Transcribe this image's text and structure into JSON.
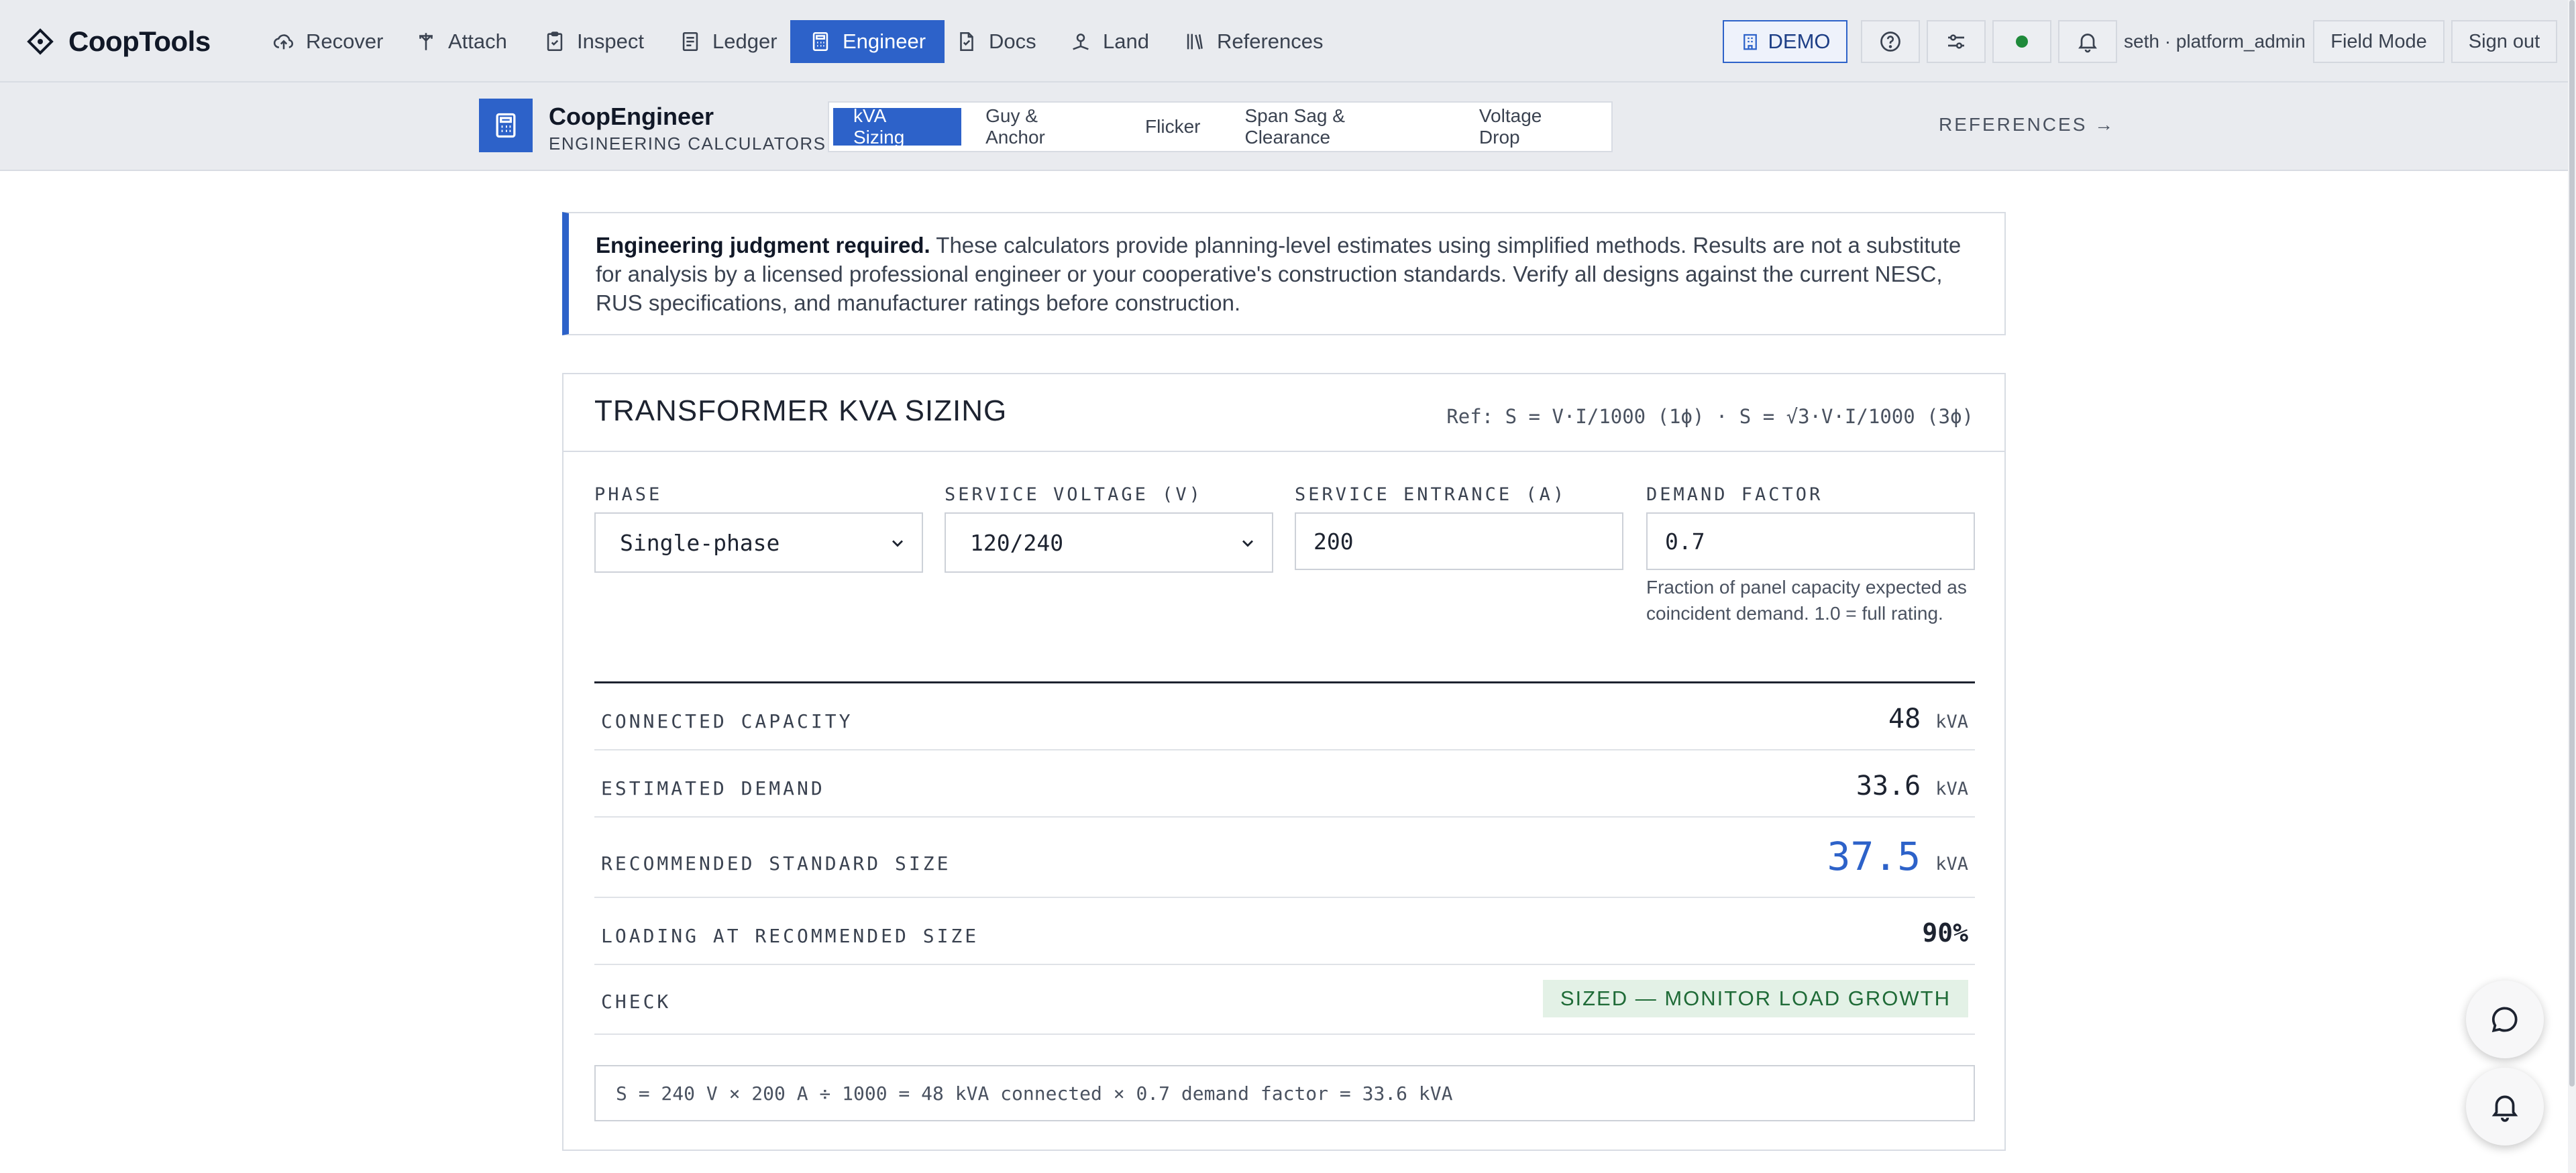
{
  "app": {
    "name": "CoopTools"
  },
  "nav": {
    "items": [
      {
        "label": "Recover",
        "icon": "cloud-upload-icon"
      },
      {
        "label": "Attach",
        "icon": "pole-icon"
      },
      {
        "label": "Inspect",
        "icon": "clipboard-check-icon"
      },
      {
        "label": "Ledger",
        "icon": "ledger-icon"
      },
      {
        "label": "Engineer",
        "icon": "calculator-icon",
        "active": true
      },
      {
        "label": "Docs",
        "icon": "document-icon"
      },
      {
        "label": "Land",
        "icon": "land-icon"
      },
      {
        "label": "References",
        "icon": "books-icon"
      }
    ],
    "demo_label": "DEMO",
    "status_color": "#1f8a3b",
    "user": "seth · platform_admin",
    "field_mode": "Field Mode",
    "sign_out": "Sign out"
  },
  "subheader": {
    "title": "CoopEngineer",
    "caption": "ENGINEERING CALCULATORS",
    "tabs": [
      "kVA Sizing",
      "Guy & Anchor",
      "Flicker",
      "Span Sag & Clearance",
      "Voltage Drop"
    ],
    "active_tab": "kVA Sizing",
    "references_link": "REFERENCES →"
  },
  "notice": {
    "bold": "Engineering judgment required.",
    "text": " These calculators provide planning-level estimates using simplified methods. Results are not a substitute for analysis by a licensed professional engineer or your cooperative's construction standards. Verify all designs against the current NESC, RUS specifications, and manufacturer ratings before construction."
  },
  "calculator": {
    "title": "TRANSFORMER KVA SIZING",
    "ref": "Ref: S = V·I/1000 (1ϕ) · S = √3·V·I/1000 (3ϕ)",
    "fields": {
      "phase": {
        "label": "PHASE",
        "value": "Single-phase"
      },
      "voltage": {
        "label": "SERVICE VOLTAGE (V)",
        "value": "120/240"
      },
      "entrance": {
        "label": "SERVICE ENTRANCE (A)",
        "value": "200"
      },
      "demand": {
        "label": "DEMAND FACTOR",
        "value": "0.7",
        "help": "Fraction of panel capacity expected as coincident demand. 1.0 = full rating."
      }
    },
    "results": {
      "connected": {
        "label": "CONNECTED CAPACITY",
        "value": "48",
        "unit": "kVA"
      },
      "demand": {
        "label": "ESTIMATED DEMAND",
        "value": "33.6",
        "unit": "kVA"
      },
      "recommended": {
        "label": "RECOMMENDED STANDARD SIZE",
        "value": "37.5",
        "unit": "kVA"
      },
      "loading": {
        "label": "LOADING AT RECOMMENDED SIZE",
        "value": "90%"
      },
      "check": {
        "label": "CHECK",
        "value": "SIZED — MONITOR LOAD GROWTH"
      }
    },
    "formula": "S = 240 V × 200 A ÷ 1000 = 48 kVA connected × 0.7 demand factor = 33.6 kVA"
  },
  "colors": {
    "accent": "#2d62c9",
    "ok_bg": "#e3f1e6",
    "ok_text": "#1f6b37"
  }
}
